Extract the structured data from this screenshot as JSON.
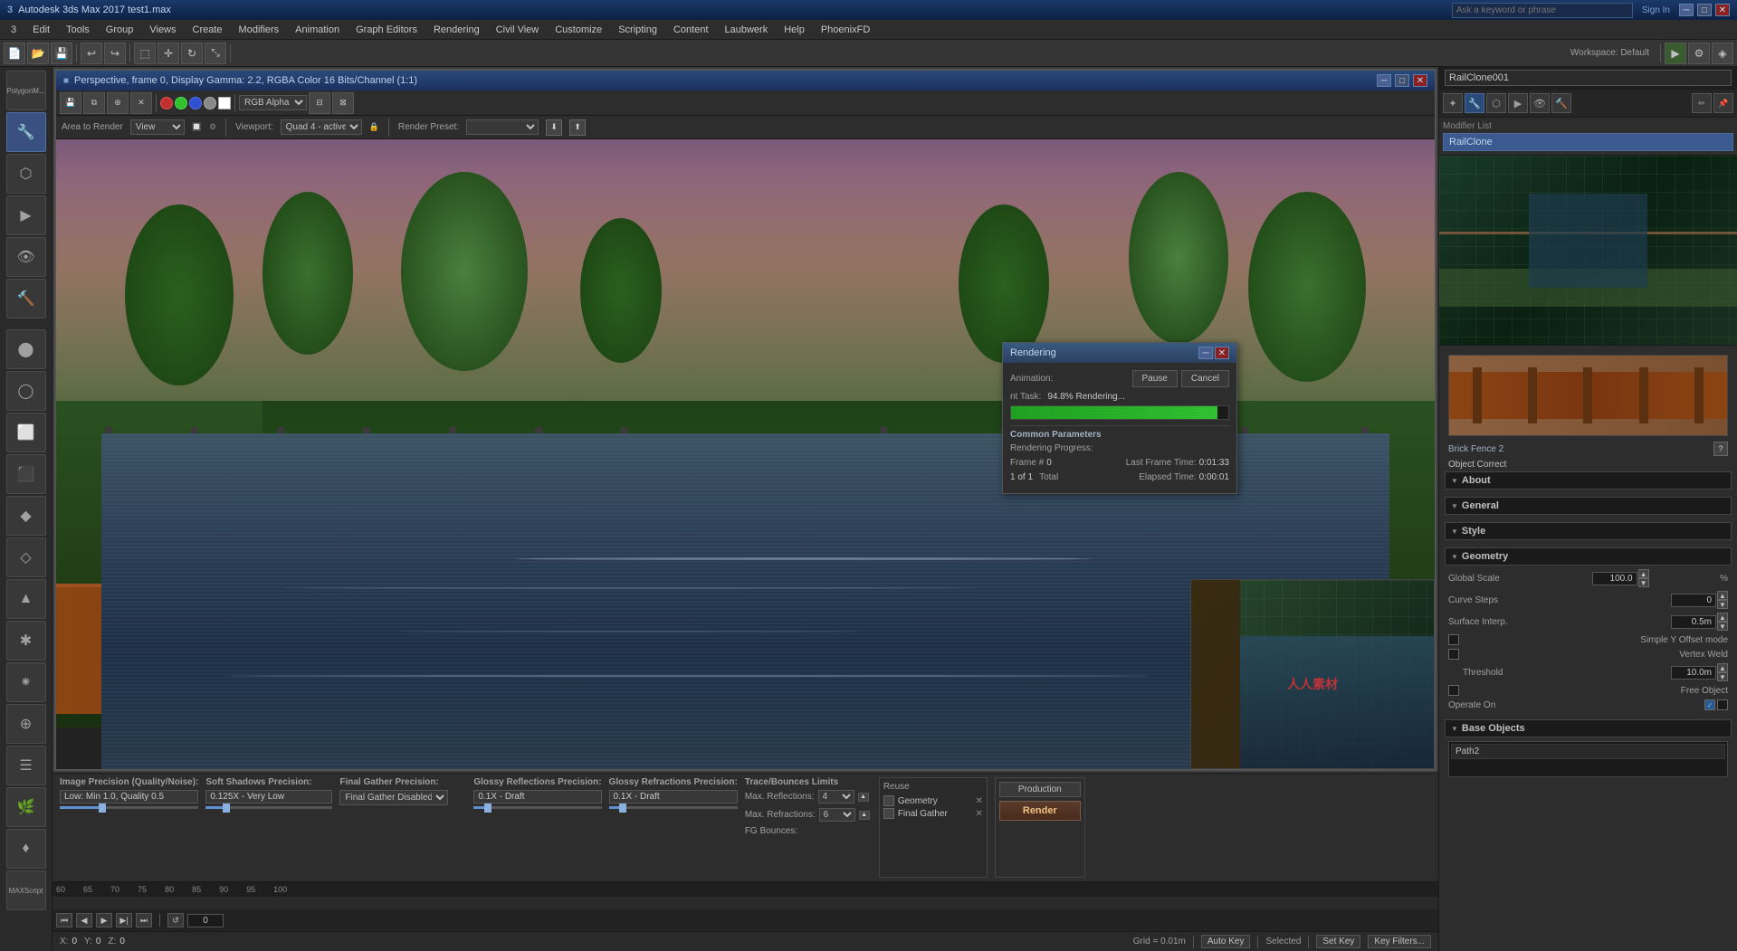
{
  "app": {
    "title": "Autodesk 3ds Max 2017   test1.max",
    "workspace": "Workspace: Default",
    "file": "test1.max"
  },
  "titlebar": {
    "search_placeholder": "Ask a keyword or phrase",
    "sign_in": "Sign In",
    "close": "✕",
    "minimize": "─",
    "maximize": "□"
  },
  "menus": [
    "3",
    "Edit",
    "Tools",
    "Group",
    "Views",
    "Create",
    "Modifiers",
    "Animation",
    "Graph Editors",
    "Rendering",
    "Civil View",
    "Customize",
    "Scripting",
    "Content",
    "Laubwerk",
    "Help",
    "PhoenixFD"
  ],
  "render_window": {
    "title": "Perspective, frame 0, Display Gamma: 2.2, RGBA Color 16 Bits/Channel (1:1)",
    "channel": "RGB Alpha",
    "area_label": "Area to Render",
    "viewport_label": "Viewport:",
    "viewport_value": "Quad 4 - active",
    "render_preset_label": "Render Preset:"
  },
  "rendering_dialog": {
    "title": "Rendering",
    "animation_label": "Animation:",
    "current_task_label": "nt Task:",
    "current_task_value": "94.8% Rendering...",
    "progress_percent": 94.8,
    "common_params_label": "Common Parameters",
    "rendering_progress_label": "Rendering Progress:",
    "frame_label": "Frame #",
    "frame_value": "0",
    "last_frame_label": "Last Frame Time:",
    "last_frame_value": "0:01:33",
    "elapsed_label": "Elapsed Time:",
    "elapsed_value": "0:00:01",
    "total_label": "Total",
    "of_label": "1 of 1",
    "pause_btn": "Pause",
    "cancel_btn": "Cancel"
  },
  "bottom_settings": {
    "image_precision_label": "Image Precision (Quality/Noise):",
    "image_precision_value": "Low: Min 1.0, Quality 0.5",
    "soft_shadows_label": "Soft Shadows Precision:",
    "soft_shadows_value": "0.125X - Very Low",
    "final_gather_label": "Final Gather Precision:",
    "final_gather_value": "Final Gather Disabled",
    "glossy_reflections_label": "Glossy Reflections Precision:",
    "glossy_reflections_value": "0.1X - Draft",
    "glossy_refractions_label": "Glossy Refractions Precision:",
    "glossy_refractions_value": "0.1X - Draft",
    "trace_bounces_label": "Trace/Bounces Limits",
    "max_reflections_label": "Max. Reflections:",
    "max_reflections_value": "4",
    "max_refractions_label": "Max. Refractions:",
    "max_refractions_value": "6",
    "fg_bounces_label": "FG Bounces:",
    "production_label": "Production",
    "render_label": "Render"
  },
  "reuse_panel": {
    "title": "Reuse",
    "geometry_label": "Geometry",
    "final_gather_label": "Final Gather"
  },
  "right_panel": {
    "object_name": "RailClone001",
    "modifier_list_label": "Modifier List",
    "modifier_name": "RailClone",
    "style_label": "Style",
    "style_name": "Brick Fence 2",
    "object_correct": "Object Correct",
    "geometry_label": "Geometry",
    "global_scale_label": "Global Scale",
    "global_scale_value": "100.0",
    "global_scale_unit": "%",
    "curve_steps_label": "Curve Steps",
    "curve_steps_value": "0",
    "surface_interp_label": "Surface Interp.",
    "surface_interp_value": "0.5m",
    "simple_y_offset_label": "Simple Y Offset mode",
    "vertex_weld_label": "Vertex Weld",
    "threshold_label": "Threshold",
    "threshold_value": "10.0m",
    "free_object_label": "Free Object",
    "operate_on_label": "Operate On",
    "base_objects_label": "Base Objects",
    "base_obj_path": "Path2",
    "sections": {
      "about": "About",
      "general": "General",
      "style": "Style",
      "geometry": "Geometry",
      "base_objects": "Base Objects"
    }
  },
  "status_bar": {
    "x_label": "X:",
    "y_label": "Y:",
    "z_label": "Z:",
    "grid_label": "Grid = 0.01m",
    "auto_key": "Auto Key",
    "selected": "Selected",
    "set_key": "Set Key",
    "key_filters": "Key Filters..."
  },
  "timeline": {
    "markers": [
      "60",
      "65",
      "70",
      "75",
      "80",
      "85",
      "90",
      "95",
      "100"
    ],
    "frame_count": "0"
  }
}
